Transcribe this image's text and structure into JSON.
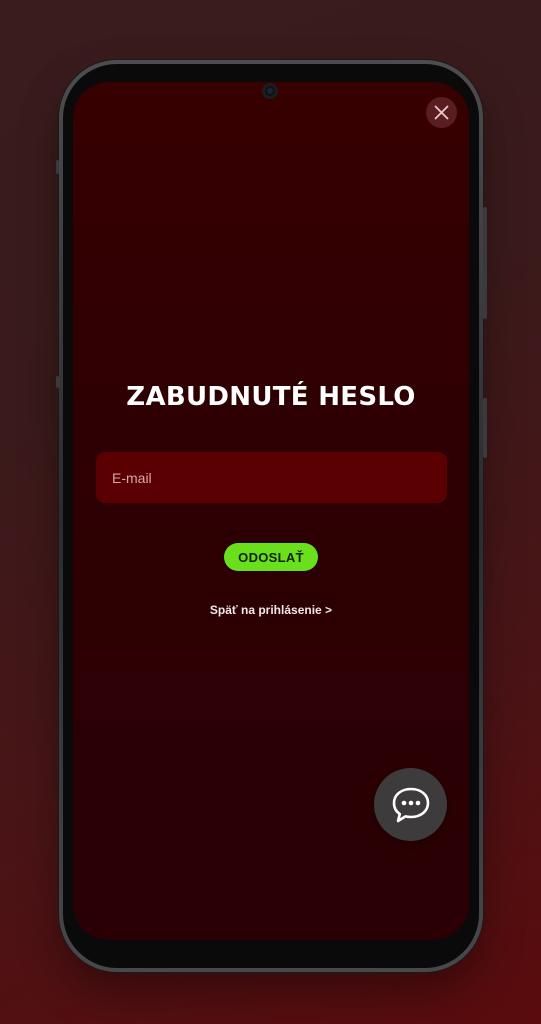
{
  "form": {
    "title": "ZABUDNUTÉ HESLO",
    "email_placeholder": "E-mail",
    "email_value": "",
    "submit_label": "ODOSLAŤ",
    "back_link": "Späť na prihlásenie >"
  },
  "icons": {
    "close": "close-icon",
    "chat": "chat-bubble-icon"
  },
  "colors": {
    "background": "#2d0003",
    "input_background": "#5a0002",
    "submit_button": "#6ae01c",
    "chat_button": "#3e3b3c"
  }
}
